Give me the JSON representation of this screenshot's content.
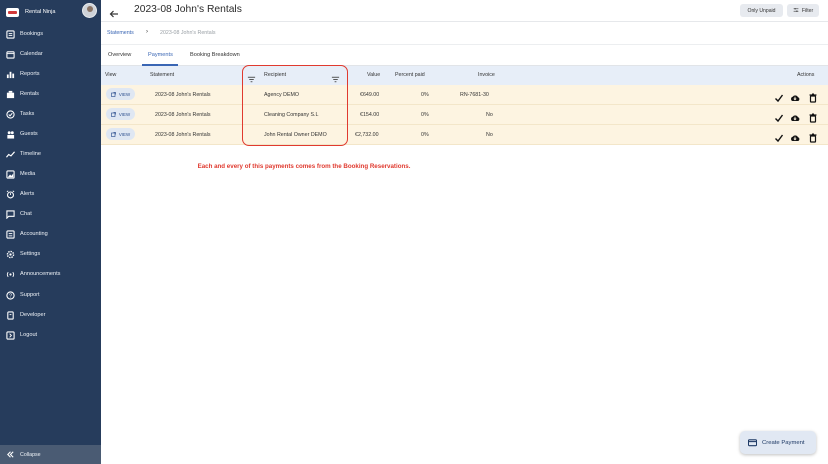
{
  "sidebar": {
    "brand": "Rental Ninja",
    "items": [
      {
        "label": "Bookings",
        "icon": "bookings-icon"
      },
      {
        "label": "Calendar",
        "icon": "calendar-icon"
      },
      {
        "label": "Reports",
        "icon": "bar-chart-icon"
      },
      {
        "label": "Rentals",
        "icon": "rentals-icon"
      },
      {
        "label": "Tasks",
        "icon": "check-circle-icon"
      },
      {
        "label": "Guests",
        "icon": "people-icon"
      },
      {
        "label": "Timeline",
        "icon": "timeline-icon"
      },
      {
        "label": "Media",
        "icon": "image-icon"
      },
      {
        "label": "Alerts",
        "icon": "alarm-icon"
      },
      {
        "label": "Chat",
        "icon": "chat-icon"
      },
      {
        "label": "Accounting",
        "icon": "accounting-icon"
      },
      {
        "label": "Settings",
        "icon": "gear-icon"
      },
      {
        "label": "Announcements",
        "icon": "broadcast-icon"
      },
      {
        "label": "Support",
        "icon": "help-icon"
      },
      {
        "label": "Developer",
        "icon": "developer-icon"
      },
      {
        "label": "Logout",
        "icon": "logout-icon"
      }
    ],
    "collapse_label": "Collapse"
  },
  "header": {
    "title": "2023-08 John's Rentals",
    "only_unpaid_label": "Only Unpaid",
    "filter_label": "Filter"
  },
  "breadcrumb": {
    "link": "Statements",
    "current": "2023-08 John's Rentals"
  },
  "tabs": [
    "Overview",
    "Payments",
    "Booking Breakdown"
  ],
  "active_tab": "Payments",
  "table": {
    "columns": {
      "view": "View",
      "statement": "Statement",
      "recipient": "Recipient",
      "value": "Value",
      "percent_paid": "Percent paid",
      "invoice": "Invoice",
      "actions": "Actions"
    },
    "view_button_label": "VIEW",
    "rows": [
      {
        "statement": "2023-08 John's Rentals",
        "recipient": "Agency DEMO",
        "value": "€649.00",
        "percent_paid": "0%",
        "invoice": "RN-7681-30"
      },
      {
        "statement": "2023-08 John's Rentals",
        "recipient": "Cleaning Company S.L",
        "value": "€154.00",
        "percent_paid": "0%",
        "invoice": "No"
      },
      {
        "statement": "2023-08 John's Rentals",
        "recipient": "John Rental Owner DEMO",
        "value": "€2,732.00",
        "percent_paid": "0%",
        "invoice": "No"
      }
    ]
  },
  "annotation": {
    "text": "Each and every of this payments comes from the Booking Reservations.",
    "color": "#e03a2f"
  },
  "create_payment_label": "Create Payment",
  "colors": {
    "sidebar_bg": "#263c5c",
    "accent": "#3a66b4",
    "row_highlight": "#fdf4e1",
    "table_header_bg": "#e7eef8"
  }
}
